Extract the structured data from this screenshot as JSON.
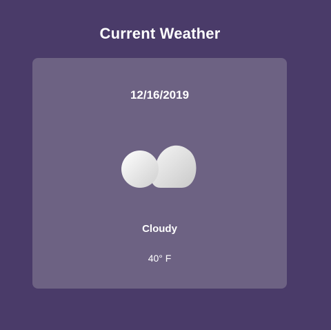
{
  "header": {
    "title": "Current Weather"
  },
  "weather_card": {
    "date": "12/16/2019",
    "icon": "cloud-icon",
    "condition": "Cloudy",
    "temperature": "40° F"
  },
  "colors": {
    "background": "#4a3b69",
    "card": "#6d6283",
    "text": "#ffffff"
  }
}
